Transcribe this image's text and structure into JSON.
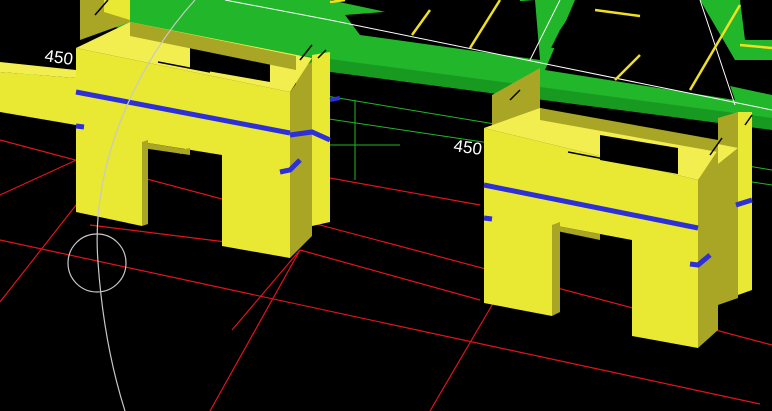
{
  "viewport": {
    "background": "#000000"
  },
  "colors": {
    "column_face": "#e9e934",
    "column_side": "#a9a525",
    "column_top": "#f2ee50",
    "slab_green": "#22b62a",
    "slab_green_dark": "#189a20",
    "rebar_blue": "#2d2fd8",
    "grid_red": "#e0141b",
    "grid_green": "#22b62a",
    "aux_line": "#c8c8c8",
    "dim_text": "#ffffff",
    "slab_joist": "#f0e020"
  },
  "dimensions": {
    "left_label": "450",
    "right_label": "450"
  },
  "icons": {
    "cursor": "circle-cursor-icon",
    "arc": "arc-guide-icon"
  }
}
